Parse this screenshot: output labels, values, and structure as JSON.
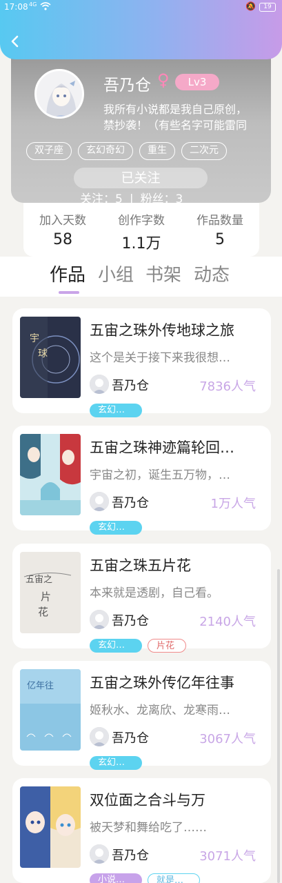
{
  "status": {
    "time": "17:08",
    "network": "4G",
    "battery": "19"
  },
  "profile": {
    "name": "吾乃仓",
    "gender_symbol": "♀",
    "level": "Lv3",
    "bio_line1": "我所有小说都是我自己原创，",
    "bio_line2": "禁抄袭！（有些名字可能雷同",
    "tags": [
      "双子座",
      "玄幻奇幻",
      "重生",
      "二次元"
    ],
    "follow_button": "已关注",
    "following_label": "关注：5",
    "fans_label": "粉丝：3",
    "separator": "|"
  },
  "stats": [
    {
      "label": "加入天数",
      "value": "58"
    },
    {
      "label": "创作字数",
      "value": "1.1万"
    },
    {
      "label": "作品数量",
      "value": "5"
    }
  ],
  "tabs": [
    "作品",
    "小组",
    "书架",
    "动态"
  ],
  "works": [
    {
      "title": "五宙之珠外传地球之旅",
      "desc": "这个是关于接下来我很想…",
      "author": "吾乃仓",
      "popularity": "7836人气",
      "tags": [
        {
          "text": "玄幻…",
          "style": "blue"
        }
      ]
    },
    {
      "title": "五宙之珠神迹篇轮回…",
      "desc": "宇宙之初，诞生五万物，…",
      "author": "吾乃仓",
      "popularity": "1万人气",
      "tags": [
        {
          "text": "玄幻…",
          "style": "blue"
        }
      ]
    },
    {
      "title": "五宙之珠五片花",
      "desc": "本来就是透剧，自己看。",
      "author": "吾乃仓",
      "popularity": "2140人气",
      "tags": [
        {
          "text": "玄幻…",
          "style": "blue"
        },
        {
          "text": "片花",
          "style": "red"
        }
      ]
    },
    {
      "title": "五宙之珠外传亿年往事",
      "desc": "姬秋水、龙离欣、龙寒雨…",
      "author": "吾乃仓",
      "popularity": "3067人气",
      "tags": [
        {
          "text": "玄幻…",
          "style": "blue"
        }
      ]
    },
    {
      "title": "双位面之合斗与万",
      "desc": "被天梦和舞给吃了……",
      "author": "吾乃仓",
      "popularity": "3071人气",
      "tags": [
        {
          "text": "小说…",
          "style": "purple"
        },
        {
          "text": "就是…",
          "style": "outline"
        }
      ]
    }
  ],
  "colors": {
    "accent": "#c9a4e8",
    "header_start": "#57c9f1",
    "header_end": "#c79be8",
    "tag_blue": "#5cd3f0"
  }
}
